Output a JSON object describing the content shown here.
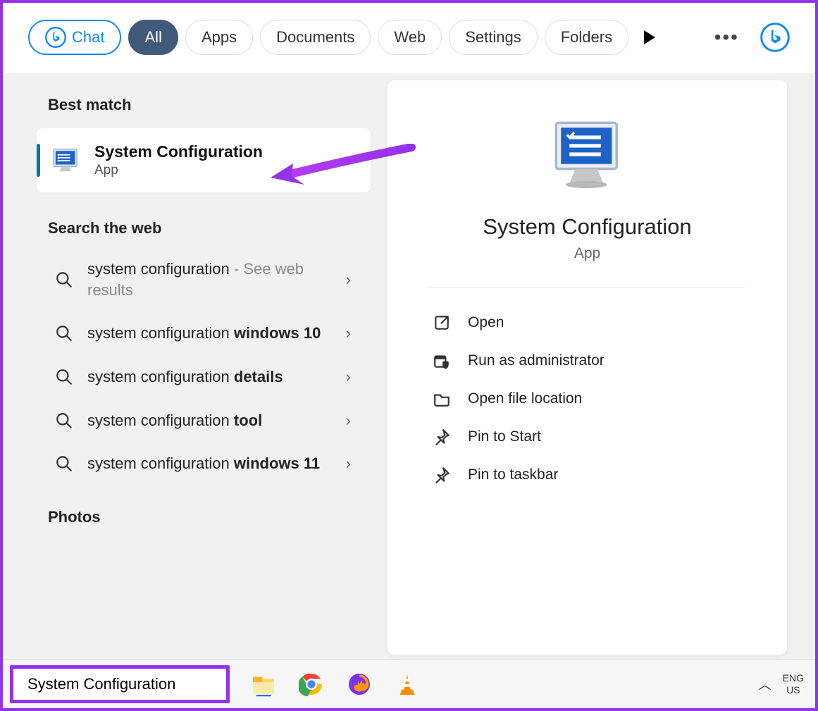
{
  "header": {
    "chat_label": "Chat",
    "filters": [
      "All",
      "Apps",
      "Documents",
      "Web",
      "Settings",
      "Folders"
    ],
    "active_filter_index": 0
  },
  "sections": {
    "best_match_label": "Best match",
    "search_web_label": "Search the web",
    "photos_label": "Photos"
  },
  "best_match": {
    "title": "System Configuration",
    "subtitle": "App"
  },
  "web_results": [
    {
      "prefix": "system configuration",
      "suffix_muted": " - See web results",
      "bold": ""
    },
    {
      "prefix": "system configuration ",
      "suffix_muted": "",
      "bold": "windows 10"
    },
    {
      "prefix": "system configuration ",
      "suffix_muted": "",
      "bold": "details"
    },
    {
      "prefix": "system configuration ",
      "suffix_muted": "",
      "bold": "tool"
    },
    {
      "prefix": "system configuration ",
      "suffix_muted": "",
      "bold": "windows 11"
    }
  ],
  "detail": {
    "title": "System Configuration",
    "subtitle": "App",
    "actions": [
      {
        "icon": "open-external-icon",
        "label": "Open"
      },
      {
        "icon": "admin-shield-icon",
        "label": "Run as administrator"
      },
      {
        "icon": "folder-icon",
        "label": "Open file location"
      },
      {
        "icon": "pin-icon",
        "label": "Pin to Start"
      },
      {
        "icon": "pin-icon",
        "label": "Pin to taskbar"
      }
    ]
  },
  "taskbar": {
    "search_value": "System Configuration",
    "lang_line1": "ENG",
    "lang_line2": "US"
  },
  "colors": {
    "accent": "#0f8af9",
    "highlight": "#9333ea"
  }
}
